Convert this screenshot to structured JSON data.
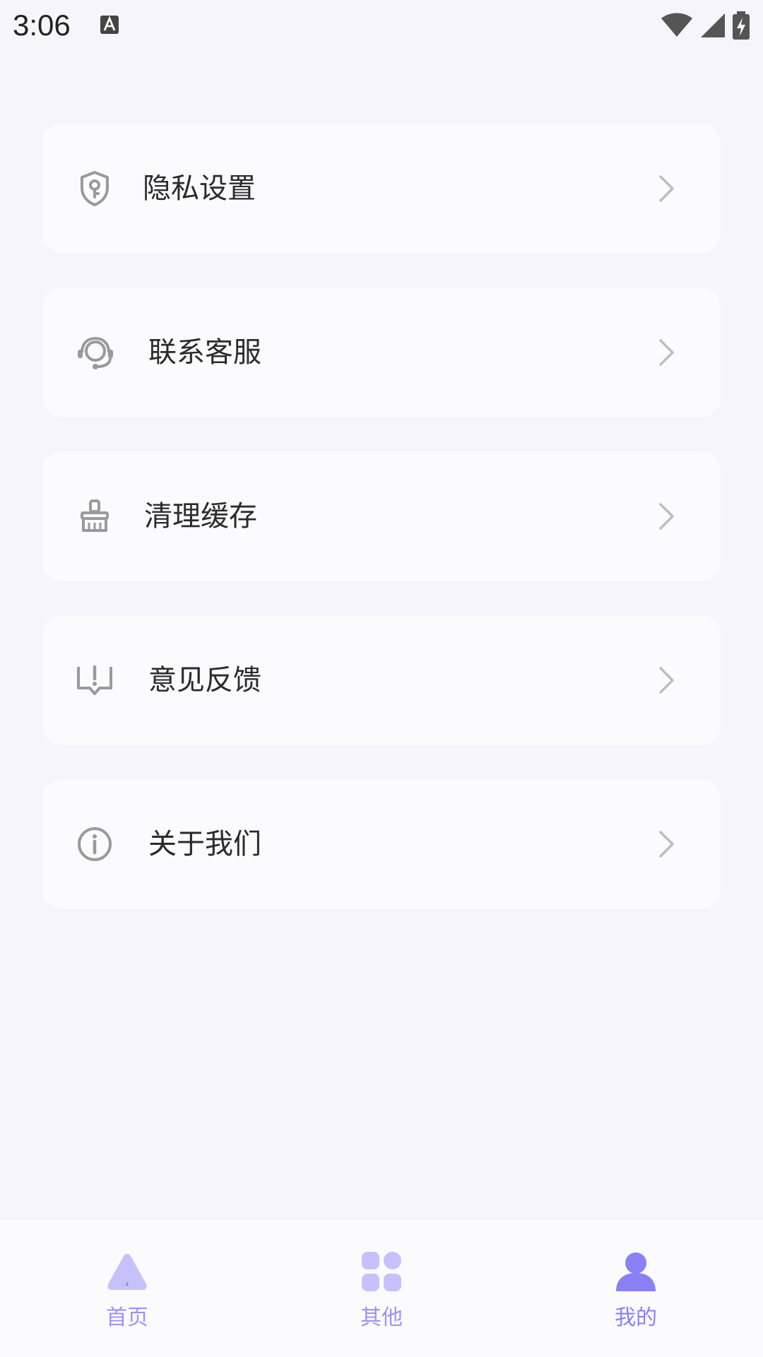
{
  "status_bar": {
    "time": "3:06",
    "icons": [
      "text-input-icon",
      "wifi-icon",
      "signal-icon",
      "battery-charging-icon"
    ]
  },
  "menu": {
    "items": [
      {
        "label": "隐私设置",
        "icon": "shield-key-icon"
      },
      {
        "label": "联系客服",
        "icon": "headset-icon"
      },
      {
        "label": "清理缓存",
        "icon": "broom-icon"
      },
      {
        "label": "意见反馈",
        "icon": "feedback-icon"
      },
      {
        "label": "关于我们",
        "icon": "info-icon"
      }
    ]
  },
  "tabs": [
    {
      "label": "首页",
      "icon": "home-icon",
      "active": false
    },
    {
      "label": "其他",
      "icon": "grid-icon",
      "active": false
    },
    {
      "label": "我的",
      "icon": "profile-icon",
      "active": true
    }
  ],
  "colors": {
    "background": "#f7f5fc",
    "card": "#fbfafd",
    "text": "#2b2b2b",
    "icon_gray": "#9a9a9a",
    "tab_active": "#8a80f6",
    "tab_inactive_icon": "#c7c1fb",
    "tab_label": "#9d93f1"
  }
}
